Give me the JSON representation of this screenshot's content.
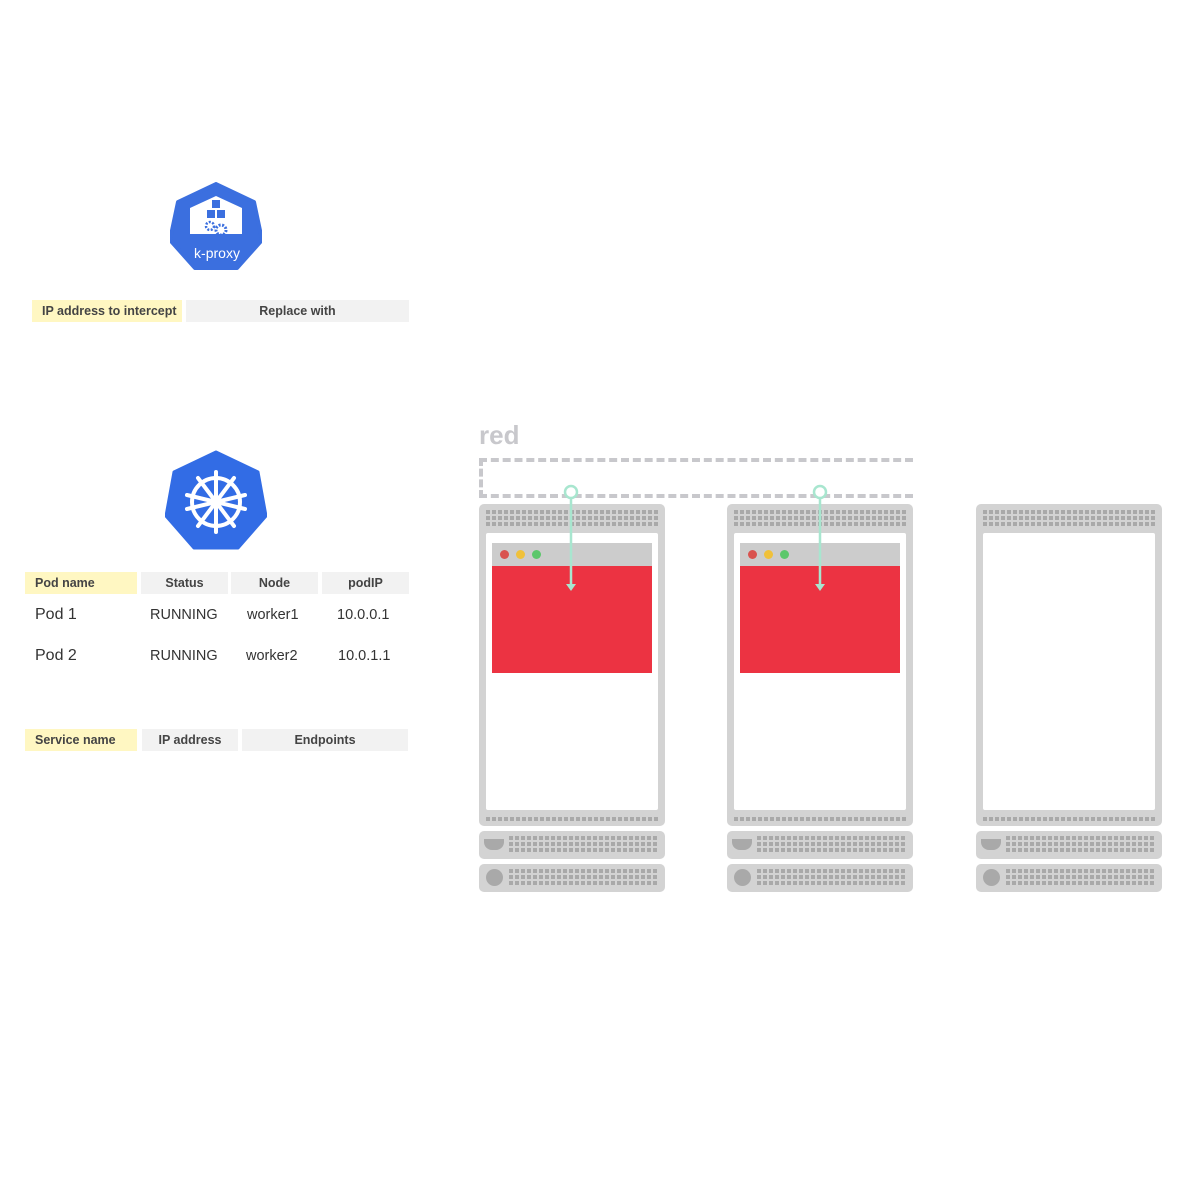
{
  "kproxy": {
    "logo_text": "k-proxy",
    "headers": [
      "IP address to intercept",
      "Replace with"
    ]
  },
  "pods": {
    "headers": [
      "Pod name",
      "Status",
      "Node",
      "podIP"
    ],
    "rows": [
      [
        "Pod 1",
        "RUNNING",
        "worker1",
        "10.0.0.1"
      ],
      [
        "Pod 2",
        "RUNNING",
        "worker2",
        "10.0.1.1"
      ]
    ]
  },
  "services": {
    "headers": [
      "Service name",
      "IP address",
      "Endpoints"
    ]
  },
  "deployment": {
    "label": "red",
    "app_color": "#ec3342"
  },
  "colors": {
    "k8s_blue": "#326ce5",
    "highlight": "#fff7c2",
    "arrow": "#a8e6cf"
  }
}
